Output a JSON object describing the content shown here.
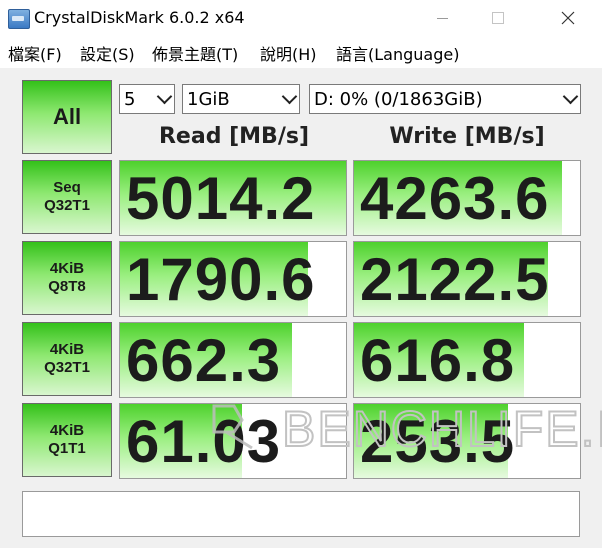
{
  "window": {
    "title": "CrystalDiskMark 6.0.2 x64"
  },
  "menu": [
    "檔案(F)",
    "設定(S)",
    "佈景主題(T)",
    "說明(H)",
    "語言(Language)"
  ],
  "controls": {
    "all_label": "All",
    "count": "5",
    "size": "1GiB",
    "drive": "D: 0% (0/1863GiB)"
  },
  "headers": {
    "read": "Read [MB/s]",
    "write": "Write [MB/s]"
  },
  "tests": [
    {
      "line1": "Seq",
      "line2": "Q32T1",
      "read": "5014.2",
      "write": "4263.6",
      "read_fill_pct": 100,
      "write_fill_pct": 92
    },
    {
      "line1": "4KiB",
      "line2": "Q8T8",
      "read": "1790.6",
      "write": "2122.5",
      "read_fill_pct": 83,
      "write_fill_pct": 86
    },
    {
      "line1": "4KiB",
      "line2": "Q32T1",
      "read": "662.3",
      "write": "616.8",
      "read_fill_pct": 76,
      "write_fill_pct": 75
    },
    {
      "line1": "4KiB",
      "line2": "Q1T1",
      "read": "61.03",
      "write": "253.5",
      "read_fill_pct": 54,
      "write_fill_pct": 68
    }
  ],
  "comment": "",
  "watermark": "BENCHLIFE.INFO",
  "colors": {
    "accent_green": "#4ed12d",
    "button_green": "#34c11a"
  },
  "icons": {
    "app": "crystaldiskmark-app-icon",
    "minimize": "minimize-icon",
    "maximize": "maximize-icon",
    "close": "close-icon",
    "dropdown": "chevron-down-icon"
  }
}
